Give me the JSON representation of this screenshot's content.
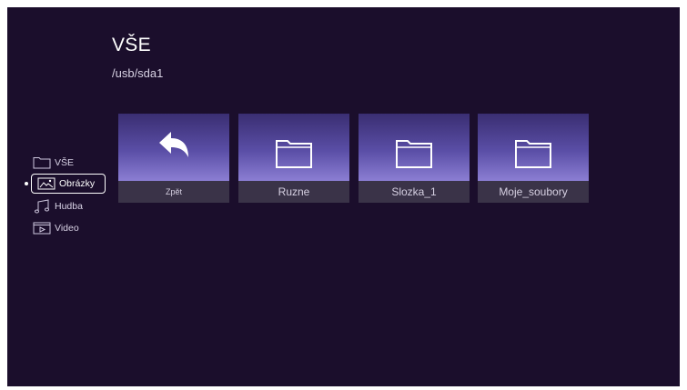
{
  "header": {
    "title": "VŠE",
    "path": "/usb/sda1"
  },
  "sidebar": {
    "items": [
      {
        "label": "VŠE",
        "icon": "folder-icon",
        "active": false
      },
      {
        "label": "Obrázky",
        "icon": "picture-icon",
        "active": true
      },
      {
        "label": "Hudba",
        "icon": "music-note-icon",
        "active": false
      },
      {
        "label": "Video",
        "icon": "video-play-icon",
        "active": false
      }
    ]
  },
  "tiles": [
    {
      "label": "Zpět",
      "icon": "back-arrow-icon"
    },
    {
      "label": "Ruzne",
      "icon": "folder-icon"
    },
    {
      "label": "Slozka_1",
      "icon": "folder-icon"
    },
    {
      "label": "Moje_soubory",
      "icon": "folder-icon"
    }
  ],
  "colors": {
    "background": "#1b0e2c",
    "tile_gradient_top": "#3a2e72",
    "tile_gradient_bottom": "#8b7ed3",
    "label_bar": "#3a3348"
  }
}
